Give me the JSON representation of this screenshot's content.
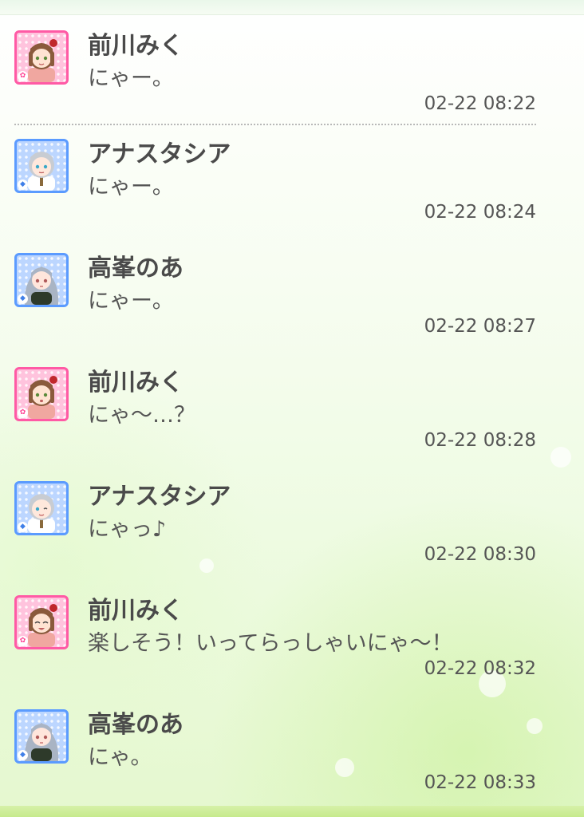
{
  "messages": [
    {
      "sender": "前川みく",
      "text": "にゃー。",
      "time": "02-22 08:22",
      "avatar_icon": "miku-avatar-icon",
      "theme": "pink",
      "badge": "✿"
    },
    {
      "sender": "アナスタシア",
      "text": "にゃー。",
      "time": "02-22 08:24",
      "avatar_icon": "anastasia-avatar-icon",
      "theme": "blue",
      "badge": "◆"
    },
    {
      "sender": "高峯のあ",
      "text": "にゃー。",
      "time": "02-22 08:27",
      "avatar_icon": "noa-avatar-icon",
      "theme": "blue",
      "badge": "◆"
    },
    {
      "sender": "前川みく",
      "text": "にゃ〜…？",
      "time": "02-22 08:28",
      "avatar_icon": "miku-avatar-icon",
      "theme": "pink",
      "badge": "✿"
    },
    {
      "sender": "アナスタシア",
      "text": "にゃっ♪",
      "time": "02-22 08:30",
      "avatar_icon": "anastasia-avatar-icon",
      "theme": "blue",
      "badge": "◆"
    },
    {
      "sender": "前川みく",
      "text": "楽しそう！いってらっしゃいにゃ〜！",
      "time": "02-22 08:32",
      "avatar_icon": "miku-avatar-icon",
      "theme": "pink",
      "badge": "✿"
    },
    {
      "sender": "高峯のあ",
      "text": "にゃ。",
      "time": "02-22 08:33",
      "avatar_icon": "noa-avatar-icon",
      "theme": "blue",
      "badge": "◆"
    }
  ],
  "colors": {
    "pink_frame": "#ff5aa5",
    "blue_frame": "#5b9bff",
    "text": "#4a4a4a"
  }
}
